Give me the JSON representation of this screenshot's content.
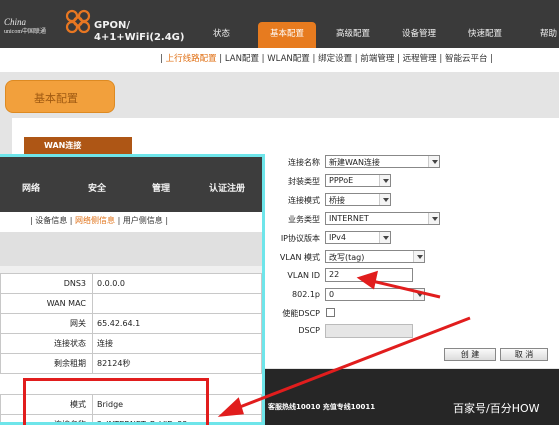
{
  "header": {
    "logo_text_line1": "China",
    "logo_text_line2": "unicom中国联通",
    "product_line1": "GPON/",
    "product_line2": "4+1+WiFi(2.4G)",
    "nav": [
      "状态",
      "基本配置",
      "高级配置",
      "设备管理",
      "快速配置",
      "帮助"
    ],
    "active_nav": "基本配置"
  },
  "subnav": {
    "items": [
      "上行线路配置",
      "LAN配置",
      "WLAN配置",
      "绑定设置",
      "前端管理",
      "远程管理",
      "智能云平台"
    ],
    "active": "上行线路配置"
  },
  "section_tab": "基本配置",
  "wan_label": "WAN连接",
  "form": {
    "connection_name": {
      "label": "连接名称",
      "value": "新建WAN连接"
    },
    "encapsulation": {
      "label": "封装类型",
      "value": "PPPoE"
    },
    "connection_mode": {
      "label": "连接模式",
      "value": "桥接"
    },
    "service_type": {
      "label": "业务类型",
      "value": "INTERNET"
    },
    "ip_version": {
      "label": "IP协议版本",
      "value": "IPv4"
    },
    "vlan_mode": {
      "label": "VLAN 模式",
      "value": "改写(tag)"
    },
    "vlan_id": {
      "label": "VLAN ID",
      "value": "22"
    },
    "priority": {
      "label": "802.1p",
      "value": "0"
    },
    "enable_dscp": {
      "label": "使能DSCP",
      "checked": false
    },
    "dscp": {
      "label": "DSCP",
      "value": ""
    },
    "create_button": "创 建",
    "cancel_button": "取 消"
  },
  "footer": {
    "hotline": "客服热线10010 充值专线10011",
    "watermark": "百家号/百分HOW"
  },
  "inset": {
    "nav": [
      "网络",
      "安全",
      "管理",
      "认证注册"
    ],
    "subnav": [
      "设备信息",
      "网络侧信息",
      "用户侧信息"
    ],
    "subnav_active": "网络侧信息",
    "rows_top": [
      {
        "key": "DNS3",
        "value": "0.0.0.0"
      },
      {
        "key": "WAN MAC",
        "value": ""
      },
      {
        "key": "网关",
        "value": "65.42.64.1"
      },
      {
        "key": "连接状态",
        "value": "连接"
      },
      {
        "key": "剩余租期",
        "value": "82124秒"
      }
    ],
    "rows_bottom": [
      {
        "key": "模式",
        "value": "Bridge"
      },
      {
        "key": "连接名称",
        "value": "2_INTERNET_B_VID_22"
      }
    ]
  },
  "colors": {
    "accent_orange": "#e77b1f",
    "highlight_red": "#e11d1d",
    "inset_border": "#6ee5ea",
    "header_dark": "#3a3a3a"
  }
}
